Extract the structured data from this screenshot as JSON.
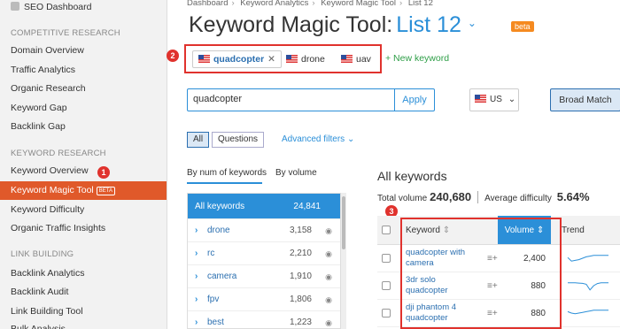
{
  "sidebar": {
    "top_item": "SEO Dashboard",
    "sections": [
      {
        "title": "COMPETITIVE RESEARCH",
        "items": [
          "Domain Overview",
          "Traffic Analytics",
          "Organic Research",
          "Keyword Gap",
          "Backlink Gap"
        ]
      },
      {
        "title": "KEYWORD RESEARCH",
        "items": [
          "Keyword Overview",
          "Keyword Magic Tool",
          "Keyword Difficulty",
          "Organic Traffic Insights"
        ]
      },
      {
        "title": "LINK BUILDING",
        "items": [
          "Backlink Analytics",
          "Backlink Audit",
          "Link Building Tool",
          "Bulk Analysis"
        ]
      }
    ],
    "beta_tag": "BETA",
    "active_item": "Keyword Magic Tool",
    "markers": [
      "1",
      "2",
      "3"
    ]
  },
  "breadcrumb": [
    "Dashboard",
    "Keyword Analytics",
    "Keyword Magic Tool",
    "List 12"
  ],
  "page": {
    "title": "Keyword Magic Tool:",
    "list_name": "List 12",
    "beta_badge": "beta"
  },
  "tabs": [
    {
      "label": "quadcopter",
      "active": true
    },
    {
      "label": "drone",
      "active": false
    },
    {
      "label": "uav",
      "active": false
    }
  ],
  "new_keyword_label": "+ New keyword",
  "search": {
    "value": "quadcopter",
    "apply_label": "Apply",
    "database": "US",
    "match_label": "Broad Match"
  },
  "filters": {
    "all_label": "All",
    "questions_label": "Questions",
    "advanced_label": "Advanced filters"
  },
  "groups": {
    "sort_tabs": [
      "By num of keywords",
      "By volume"
    ],
    "header": {
      "name": "All keywords",
      "count": "24,841"
    },
    "rows": [
      {
        "name": "drone",
        "count": "3,158"
      },
      {
        "name": "rc",
        "count": "2,210"
      },
      {
        "name": "camera",
        "count": "1,910"
      },
      {
        "name": "fpv",
        "count": "1,806"
      },
      {
        "name": "best",
        "count": "1,223"
      }
    ]
  },
  "results": {
    "heading": "All keywords",
    "total_volume_label": "Total volume",
    "total_volume": "240,680",
    "avg_difficulty_label": "Average difficulty",
    "avg_difficulty": "5.64%",
    "columns": [
      "Keyword",
      "Volume",
      "Trend"
    ],
    "rows": [
      {
        "keyword": "quadcopter with camera",
        "volume": "2,400",
        "trend": [
          0.55,
          0.3,
          0.35,
          0.4,
          0.5,
          0.6,
          0.65,
          0.7,
          0.7,
          0.7,
          0.7,
          0.7
        ]
      },
      {
        "keyword": "3dr solo quadcopter",
        "volume": "880",
        "trend": [
          0.7,
          0.7,
          0.7,
          0.68,
          0.66,
          0.6,
          0.2,
          0.5,
          0.65,
          0.7,
          0.7,
          0.7
        ]
      },
      {
        "keyword": "dji phantom 4 quadcopter",
        "volume": "880",
        "trend": [
          0.6,
          0.5,
          0.45,
          0.5,
          0.55,
          0.6,
          0.65,
          0.7,
          0.7,
          0.7,
          0.7,
          0.7
        ]
      }
    ]
  },
  "colors": {
    "accent": "#2b8fd8",
    "active_nav": "#e0592a",
    "highlight_box": "#e0322d",
    "new_keyword": "#2e9e47"
  }
}
